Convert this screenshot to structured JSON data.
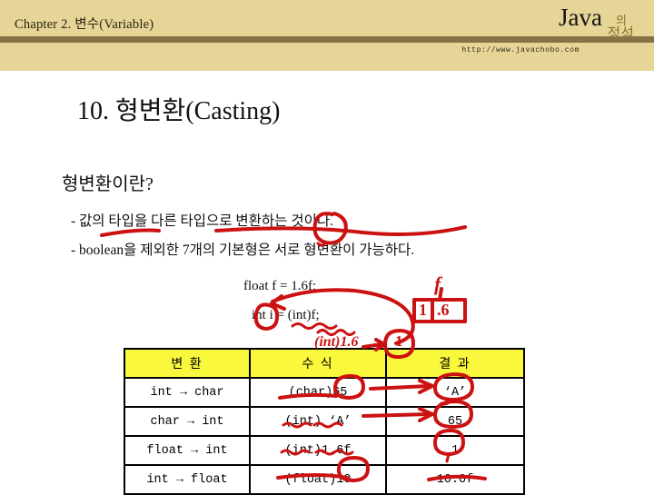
{
  "header": {
    "chapter": "Chapter 2. 변수(Variable)",
    "brand_main": "Java",
    "brand_particle": "의",
    "brand_sub": "정석",
    "url": "http://www.javachobo.com",
    "band_color": "#e6d596",
    "rule_color": "#857247",
    "brand_sub_color": "#8a7430"
  },
  "slide": {
    "title": "10. 형변환(Casting)",
    "section_heading": "형변환이란?",
    "bullets": [
      "- 값의 타입을 다른 타입으로 변환하는 것이다.",
      "- boolean을 제외한 7개의 기본형은 서로 형변환이 가능하다."
    ],
    "code_lines": [
      "float f = 1.6f;",
      "int i = (int)f;"
    ]
  },
  "table": {
    "header_bg": "#f9f83c",
    "columns": [
      "변 환",
      "수 식",
      "결 과"
    ],
    "rows": [
      {
        "conversion": "int → char",
        "expression": "(char)65",
        "result": "‘A’"
      },
      {
        "conversion": "char → int",
        "expression": "(int) ‘A’",
        "result": "65"
      },
      {
        "conversion": "float → int",
        "expression": "(int)1.6f",
        "result": "1"
      },
      {
        "conversion": "int → float",
        "expression": "(float)10",
        "result": "10.0f"
      }
    ]
  },
  "annotations": {
    "ink_color": "#cc1111",
    "f_label": "f",
    "box_value_left": "1",
    "box_value_right": ".6",
    "inline_note": "(int)1.6",
    "circled_result": "1"
  }
}
